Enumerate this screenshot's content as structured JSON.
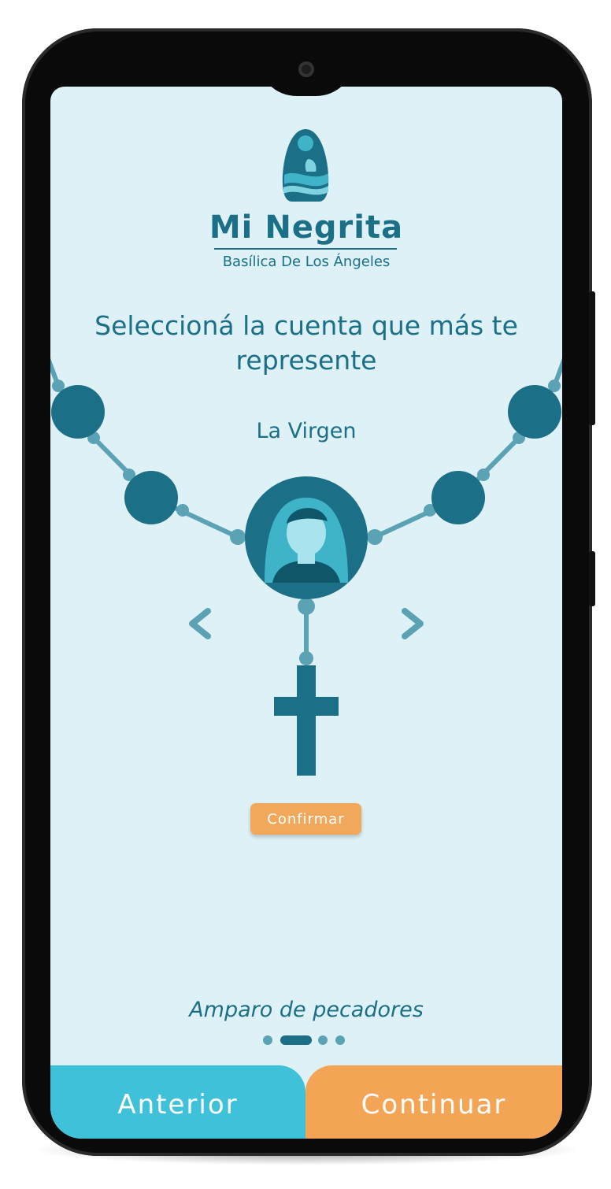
{
  "app": {
    "title": "Mi Negrita",
    "subtitle": "Basílica De Los Ángeles"
  },
  "screen": {
    "heading": "Seleccioná la cuenta que más te represente",
    "selected_name": "La Virgen",
    "confirm_label": "Confirmar",
    "tagline": "Amparo de pecadores",
    "page_indicator": {
      "count": 4,
      "active": 2
    }
  },
  "nav": {
    "prev_label": "Anterior",
    "next_label": "Continuar"
  },
  "icons": {
    "logo": "virgin-logo-icon",
    "avatar": "virgin-avatar-icon",
    "prev": "chevron-left-icon",
    "next": "chevron-right-icon",
    "cross": "cross-icon"
  },
  "colors": {
    "accent": "#1b6f86",
    "background": "#def1f7",
    "confirm": "#f2a85a",
    "prev_button": "#3fc1d9",
    "next_button": "#f3a555"
  }
}
